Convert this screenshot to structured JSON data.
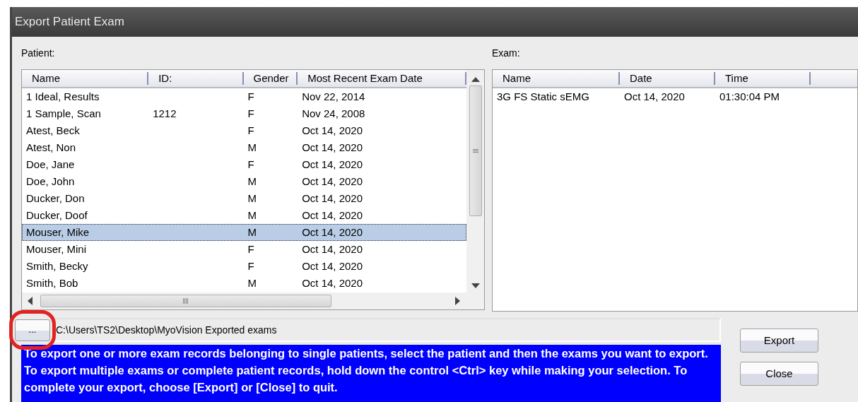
{
  "window": {
    "title": "Export Patient Exam"
  },
  "patient_list": {
    "label": "Patient:",
    "columns": [
      "Name",
      "ID:",
      "Gender",
      "Most Recent Exam Date"
    ],
    "rows": [
      {
        "cells": [
          "1 Ideal, Results",
          "",
          "F",
          "Nov 22, 2014"
        ],
        "selected": false
      },
      {
        "cells": [
          "1 Sample, Scan",
          "1212",
          "F",
          "Nov 24, 2008"
        ],
        "selected": false
      },
      {
        "cells": [
          "Atest, Beck",
          "",
          "F",
          "Oct 14, 2020"
        ],
        "selected": false
      },
      {
        "cells": [
          "Atest, Non",
          "",
          "M",
          "Oct 14, 2020"
        ],
        "selected": false
      },
      {
        "cells": [
          "Doe, Jane",
          "",
          "F",
          "Oct 14, 2020"
        ],
        "selected": false
      },
      {
        "cells": [
          "Doe, John",
          "",
          "M",
          "Oct 14, 2020"
        ],
        "selected": false
      },
      {
        "cells": [
          "Ducker, Don",
          "",
          "M",
          "Oct 14, 2020"
        ],
        "selected": false
      },
      {
        "cells": [
          "Ducker, Doof",
          "",
          "M",
          "Oct 14, 2020"
        ],
        "selected": false
      },
      {
        "cells": [
          "Mouser, Mike",
          "",
          "M",
          "Oct 14, 2020"
        ],
        "selected": true
      },
      {
        "cells": [
          "Mouser, Mini",
          "",
          "F",
          "Oct 14, 2020"
        ],
        "selected": false
      },
      {
        "cells": [
          "Smith, Becky",
          "",
          "F",
          "Oct 14, 2020"
        ],
        "selected": false
      },
      {
        "cells": [
          "Smith, Bob",
          "",
          "M",
          "Oct 14, 2020"
        ],
        "selected": false
      }
    ]
  },
  "exam_list": {
    "label": "Exam:",
    "columns": [
      "Name",
      "Date",
      "Time"
    ],
    "rows": [
      {
        "cells": [
          "3G FS Static sEMG",
          "Oct 14, 2020",
          "01:30:04 PM"
        ],
        "selected": false
      }
    ]
  },
  "browse_button": {
    "label": "...",
    "circled": true
  },
  "export_path": {
    "value": "C:\\Users\\TS2\\Desktop\\MyoVision Exported exams"
  },
  "help_text": "To export one or more exam records belonging to single patients, select the patient and then the exams you want to export. To export multiple exams or complete patient records, hold down the control <Ctrl> key while making your selection. To complete your export, choose [Export] or [Close] to quit.",
  "buttons": [
    "Export",
    "Close"
  ]
}
